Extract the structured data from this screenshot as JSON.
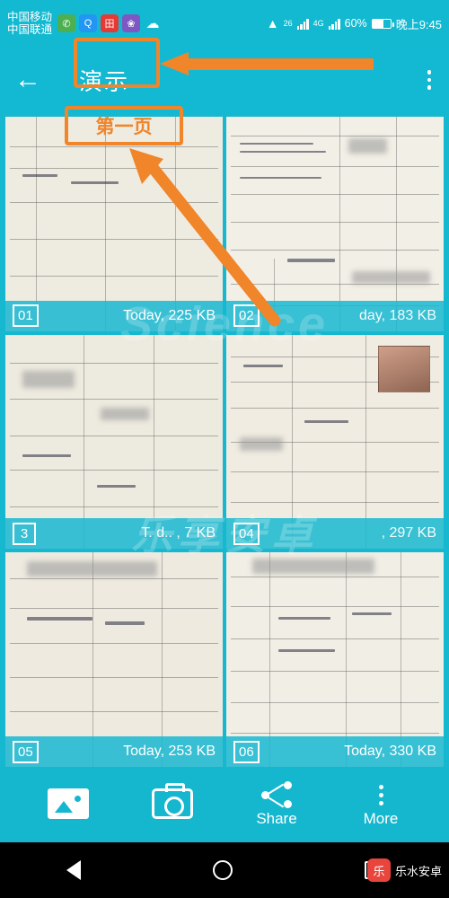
{
  "status_bar": {
    "carrier_line1": "中国移动",
    "carrier_line2": "中国联通",
    "icons": [
      "chat-icon",
      "qq-icon",
      "red-app-icon",
      "purple-app-icon",
      "cloud-icon"
    ],
    "wifi": "wifi-icon",
    "network_label": "26",
    "network_label2": "4G",
    "battery_percent": "60%",
    "clock": "晚上9:45"
  },
  "app_bar": {
    "back_icon": "back-arrow-icon",
    "title": "演示",
    "overflow_icon": "overflow-menu-icon"
  },
  "annotations": {
    "title_box_label": "演示",
    "page_box_label": "第一页",
    "accent_color": "#f0852a"
  },
  "grid": {
    "watermark": "Science",
    "watermark2": "乐享安卓",
    "items": [
      {
        "number": "01",
        "meta": "Today, 225 KB",
        "page_label": "第一页"
      },
      {
        "number": "02",
        "meta": "day, 183 KB"
      },
      {
        "number": "3",
        "meta": "T. d.. , 7 KB"
      },
      {
        "number": "04",
        "meta": ", 297 KB"
      },
      {
        "number": "05",
        "meta": "Today, 253 KB"
      },
      {
        "number": "06",
        "meta": "Today, 330 KB"
      }
    ]
  },
  "bottom_bar": {
    "gallery_icon": "gallery-icon",
    "gallery_label": "",
    "camera_icon": "camera-icon",
    "camera_label": "",
    "share_icon": "share-icon",
    "share_label": "Share",
    "more_icon": "more-icon",
    "more_label": "More"
  },
  "nav_bar": {
    "back": "nav-back-icon",
    "home": "nav-home-icon",
    "recent": "nav-recent-icon",
    "brand_logo": "乐",
    "brand_text": "乐水安卓"
  }
}
